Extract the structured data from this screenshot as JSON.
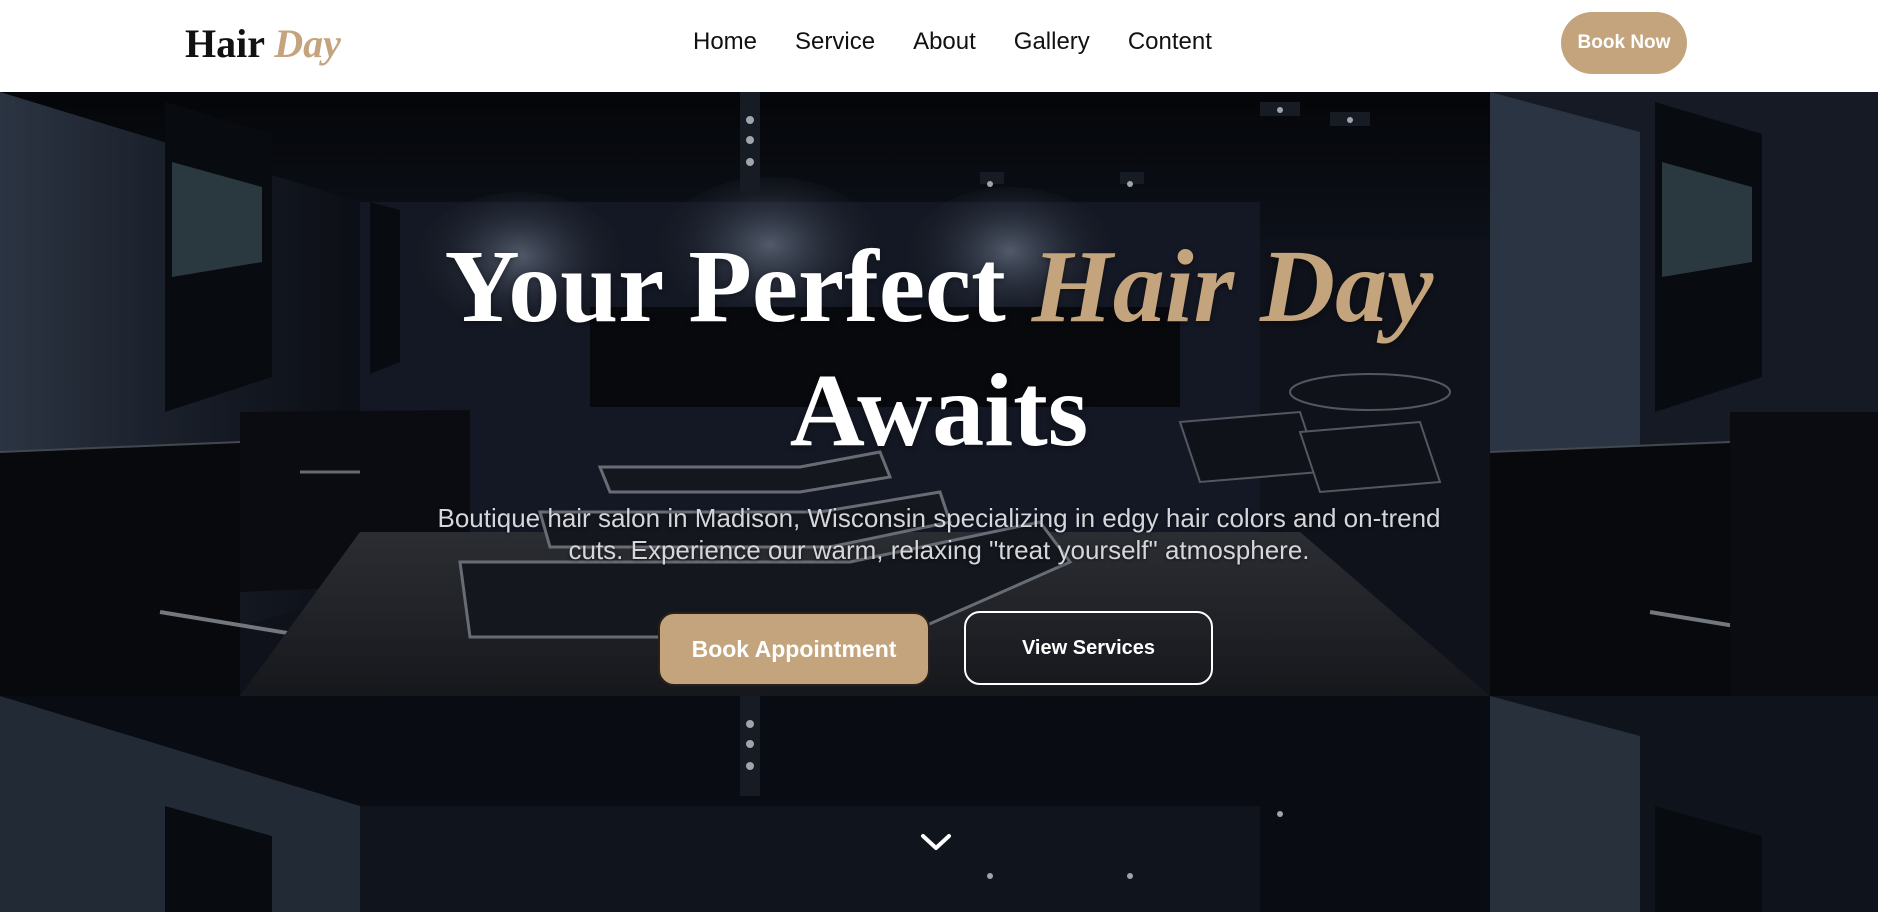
{
  "colors": {
    "accent": "#c4a47c",
    "nav_bg": "#ffffff",
    "text_dark": "#111111"
  },
  "brand": {
    "name_main": "Hair",
    "name_accent": "Day"
  },
  "nav": {
    "items": [
      {
        "label": "Home"
      },
      {
        "label": "Service"
      },
      {
        "label": "About"
      },
      {
        "label": "Gallery"
      },
      {
        "label": "Content"
      }
    ],
    "book_now_label": "Book Now"
  },
  "hero": {
    "title_main": "Your Perfect",
    "title_accent": "Hair Day",
    "title_end": "Awaits",
    "subtitle": "Boutique hair salon in Madison, Wisconsin specializing in edgy hair colors and on-trend cuts. Experience our warm, relaxing \"treat yourself\" atmosphere.",
    "primary_cta": "Book Appointment",
    "secondary_cta": "View Services"
  },
  "icons": {
    "scroll_indicator": "chevron-down-icon"
  }
}
